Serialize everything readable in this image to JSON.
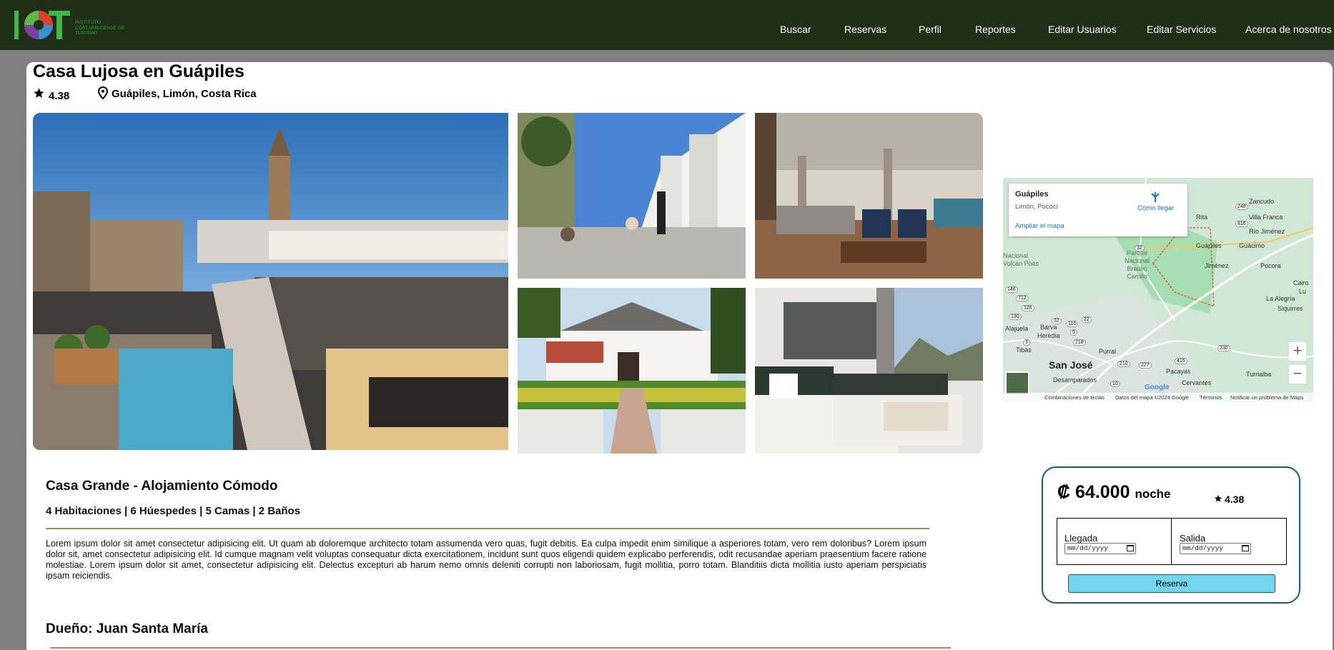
{
  "nav": {
    "logo_text": [
      "INSTITUTO",
      "COSTARRICENSE DE",
      "TURISMO"
    ],
    "items": [
      "Buscar",
      "Reservas",
      "Perfil",
      "Reportes",
      "Editar Usuarios",
      "Editar Servicios",
      "Acerca de nosotros"
    ]
  },
  "listing": {
    "title": "Casa Lujosa en Guápiles",
    "rating": "4.38",
    "location": "Guápiles, Limón, Costa Rica",
    "subtitle": "Casa Grande - Alojamiento Cómodo",
    "specs": "4 Habitaciones | 6 Húespedes | 5 Camas | 2 Baños",
    "description": "Lorem ipsum dolor sit amet consectetur adipisicing elit. Ut quam ab doloremque architecto totam assumenda vero quas, fugit debitis. Ea culpa impedit enim similique a asperiores totam, vero rem doloribus? Lorem ipsum dolor sit, amet consectetur adipisicing elit. Id cumque magnam velit voluptas consequatur dicta exercitationem, incidunt sunt quos eligendi quidem explicabo perferendis, odit recusandae aperiam praesentium facere ratione molestiae. Lorem ipsum dolor sit amet, consectetur adipisicing elit. Delectus excepturi ab harum nemo omnis deleniti corrupti non laboriosam, fugit mollitia, porro totam. Blanditiis dicta mollitia iusto aperiam perspiciatis ipsam reiciendis.",
    "owner": "Dueño: Juan Santa María"
  },
  "map": {
    "place_name": "Guápiles",
    "place_sub": "Limón, Pococí",
    "directions": "Cómo llegar",
    "expand": "Ampliar el mapa",
    "zoom_in": "+",
    "zoom_out": "−",
    "labels": [
      "Zancudo",
      "Villa Franca",
      "Rita",
      "Río Jiménez",
      "Parque",
      "Nacional",
      "Braulio",
      "Carrillo",
      "Guápiles",
      "Guácimo",
      "Jiménez",
      "Pocora",
      "Nacional",
      "Volcán Poás",
      "Cairo",
      "Lu",
      "La Alegría",
      "Siquirres",
      "Alajuela",
      "Barva",
      "Heredia",
      "San José",
      "Purral",
      "Desamparados",
      "Pacayas",
      "Turrialba",
      "Cervantes",
      "Tibás"
    ],
    "roads": [
      "248",
      "816",
      "32",
      "146",
      "712",
      "126",
      "130",
      "32",
      "22",
      "116",
      "5",
      "3",
      "218",
      "415",
      "230",
      "227",
      "10",
      "210"
    ],
    "footer": [
      "Combinaciones de teclas",
      "Datos del mapa ©2024 Google",
      "Términos",
      "Notificar un problema de Maps"
    ],
    "google": "Google"
  },
  "booking": {
    "currency": "₡",
    "price": "64.000",
    "unit": "noche",
    "rating": "4.38",
    "checkin_label": "Llegada",
    "checkout_label": "Salida",
    "date_placeholder": "mm/dd/yyyy",
    "button": "Reserva"
  },
  "colors": {
    "navbar": "#1f2f18",
    "accent_teal": "#13607a",
    "button": "#72d4ee",
    "divider": "#8a9a55"
  },
  "icons": [
    "star-icon",
    "location-pin-icon",
    "directions-icon",
    "calendar-icon"
  ]
}
